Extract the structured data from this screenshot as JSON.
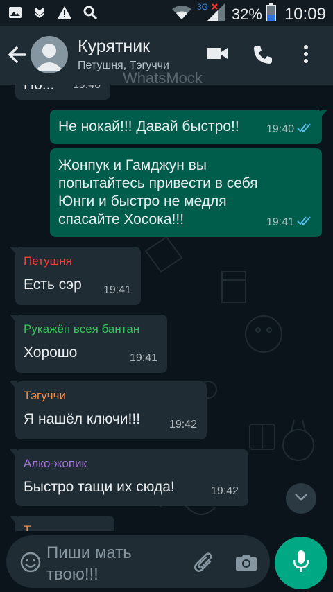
{
  "status_bar": {
    "network_label": "3G",
    "battery_percent": "32%",
    "time": "10:09"
  },
  "header": {
    "chat_name": "Курятник",
    "members": "Петушня, Тэгуччи",
    "watermark": "WhatsMock"
  },
  "messages": [
    {
      "direction": "incoming",
      "text": "Но...",
      "time": "19:40"
    },
    {
      "direction": "outgoing",
      "text": "Не нокай!!! Давай быстро!!",
      "time": "19:40",
      "status": "read"
    },
    {
      "direction": "outgoing",
      "text": "Жонпук и Гамджун вы попытайтесь привести в себя Юнги и быстро не медля спасайте Хосока!!!",
      "time": "19:41",
      "status": "read"
    },
    {
      "direction": "incoming",
      "sender": "Петушня",
      "sender_color": "#f53d3d",
      "text": "Есть сэр",
      "time": "19:41"
    },
    {
      "direction": "incoming",
      "sender": "Рукажёп всея бантан",
      "sender_color": "#35c759",
      "text": "Хорошо",
      "time": "19:41"
    },
    {
      "direction": "incoming",
      "sender": "Тэгуччи",
      "sender_color": "#ff8a3d",
      "text": "Я нашёл ключи!!!",
      "time": "19:42"
    },
    {
      "direction": "incoming",
      "sender": "Алко-жопик",
      "sender_color": "#a678e0",
      "text": "Быстро тащи их сюда!",
      "time": "19:42"
    },
    {
      "direction": "incoming",
      "sender": "Т...",
      "sender_color": "#ff8a3d",
      "text": "",
      "time": ""
    }
  ],
  "composer": {
    "placeholder": "Пиши мать твою!!!"
  },
  "colors": {
    "header_bg": "#1f2c34",
    "chat_bg": "#0b141a",
    "outgoing_bubble": "#005c4b",
    "incoming_bubble": "#1f2c34",
    "read_ticks": "#53bdeb",
    "accent": "#00a884"
  },
  "icons": [
    "gallery-icon",
    "shield-icon",
    "warning-icon",
    "search-icon",
    "wifi-icon",
    "signal-icon",
    "battery-icon",
    "back-arrow-icon",
    "video-call-icon",
    "phone-icon",
    "more-vert-icon",
    "emoji-icon",
    "attach-icon",
    "camera-icon",
    "mic-icon",
    "chevron-down-icon"
  ]
}
